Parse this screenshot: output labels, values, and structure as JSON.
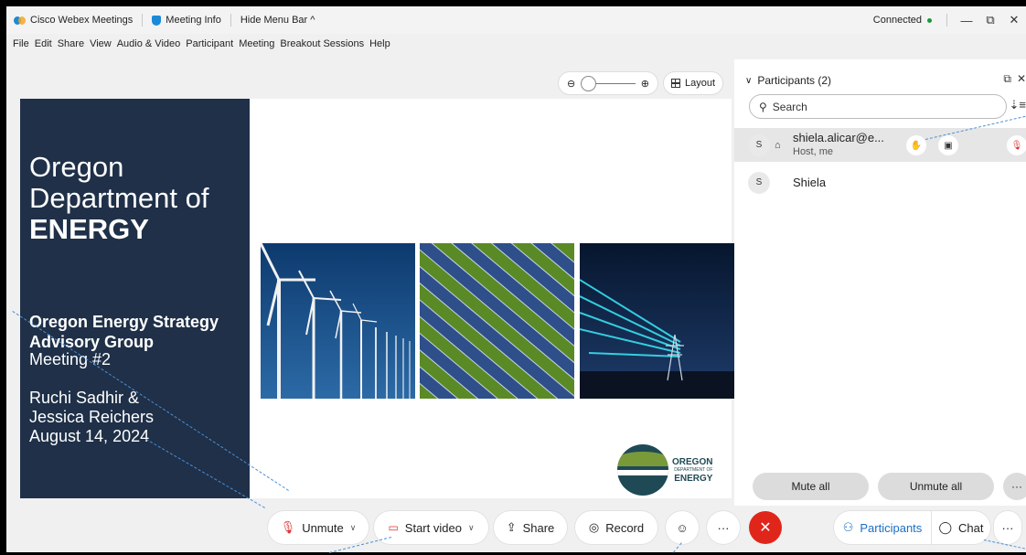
{
  "titlebar": {
    "app_name": "Cisco Webex Meetings",
    "meeting_info": "Meeting Info",
    "hide_menu": "Hide Menu Bar ^",
    "status": "Connected",
    "minimize": "—",
    "restore": "⧉",
    "close": "✕"
  },
  "menu": [
    "File",
    "Edit",
    "Share",
    "View",
    "Audio & Video",
    "Participant",
    "Meeting",
    "Breakout Sessions",
    "Help"
  ],
  "stage": {
    "zoom_out_icon": "⊖",
    "zoom_in_icon": "⊕",
    "layout_label": "Layout"
  },
  "slide": {
    "title_line1": "Oregon",
    "title_line2": "Department of",
    "title_line3": "ENERGY",
    "subtitle_line1": "Oregon Energy Strategy",
    "subtitle_line2": "Advisory Group",
    "meeting": "Meeting #2",
    "author1": "Ruchi Sadhir &",
    "author2": "Jessica Reichers",
    "date": "August 14, 2024",
    "logo_line1": "OREGON",
    "logo_line2": "DEPARTMENT OF",
    "logo_line3": "ENERGY"
  },
  "controls": {
    "unmute": "Unmute",
    "start_video": "Start video",
    "share": "Share",
    "record": "Record",
    "more": "···",
    "participants": "Participants",
    "chat": "Chat",
    "end_icon": "✕"
  },
  "panel": {
    "title": "Participants (2)",
    "search_placeholder": "Search",
    "participants": [
      {
        "initial": "S",
        "name": "shiela.alicar@e...",
        "role": "Host, me"
      },
      {
        "initial": "S",
        "name": "Shiela",
        "role": ""
      }
    ],
    "mute_all": "Mute all",
    "unmute_all": "Unmute all",
    "more": "···"
  },
  "colors": {
    "slide_panel": "#1f3048",
    "end_call": "#e0261b",
    "accent_blue": "#1a6fc4",
    "connected": "#1a9a3a",
    "muted_red": "#d33333"
  }
}
